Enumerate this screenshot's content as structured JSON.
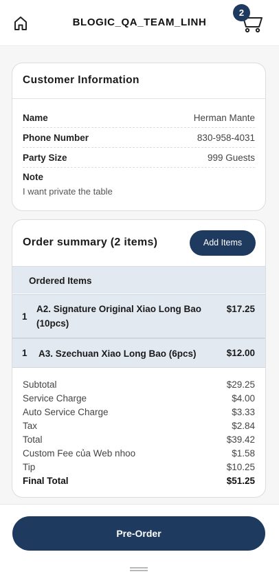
{
  "header": {
    "title": "BLOGIC_QA_TEAM_LINH",
    "cart_count": "2",
    "home_icon": "home-icon",
    "cart_icon": "cart-icon"
  },
  "customer": {
    "heading": "Customer Information",
    "rows": [
      {
        "label": "Name",
        "value": "Herman Mante"
      },
      {
        "label": "Phone Number",
        "value": "830-958-4031"
      },
      {
        "label": "Party Size",
        "value": "999 Guests"
      }
    ],
    "note_label": "Note",
    "note_text": "I want private the table"
  },
  "order": {
    "title": "Order summary (2 items)",
    "add_items_label": "Add Items",
    "ordered_items_heading": "Ordered Items",
    "items": [
      {
        "qty": "1",
        "name": "A2. Signature Original Xiao Long Bao (10pcs)",
        "price": "$17.25"
      },
      {
        "qty": "1",
        "name": "A3. Szechuan Xiao Long Bao (6pcs)",
        "price": "$12.00"
      }
    ],
    "summary": [
      {
        "label": "Subtotal",
        "value": "$29.25"
      },
      {
        "label": "Service Charge",
        "value": "$4.00"
      },
      {
        "label": "Auto Service Charge",
        "value": "$3.33"
      },
      {
        "label": "Tax",
        "value": "$2.84"
      },
      {
        "label": "Total",
        "value": "$39.42"
      },
      {
        "label": "Custom Fee của Web nhoo",
        "value": "$1.58"
      },
      {
        "label": "Tip",
        "value": "$10.25"
      },
      {
        "label": "Final Total",
        "value": "$51.25"
      }
    ]
  },
  "footer": {
    "preorder_label": "Pre-Order"
  },
  "colors": {
    "primary": "#1f3a5f",
    "row_highlight": "#e3e9f1"
  }
}
